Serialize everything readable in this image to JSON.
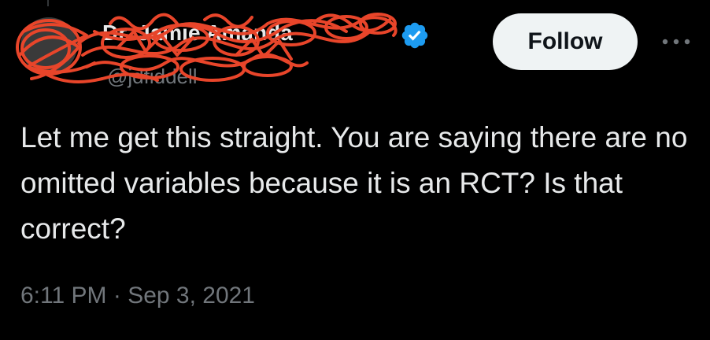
{
  "tweet": {
    "author": {
      "display_name": "Dr. Jamie Amanda",
      "handle": "@jdfiddell",
      "verified": true,
      "avatar_icon": "avatar-icon"
    },
    "follow_label": "Follow",
    "more_icon": "more-icon",
    "text": "Let me get this straight. You are saying there are no omitted variables because it is an RCT? Is that correct?",
    "time": "6:11 PM",
    "separator": "·",
    "date": "Sep 3, 2021"
  },
  "colors": {
    "background": "#000000",
    "text_primary": "#e7e9ea",
    "text_secondary": "#71767b",
    "button_bg": "#eff3f4",
    "button_text": "#0f1419",
    "verified_blue": "#1d9bf0",
    "redaction_red": "#e8452a"
  }
}
